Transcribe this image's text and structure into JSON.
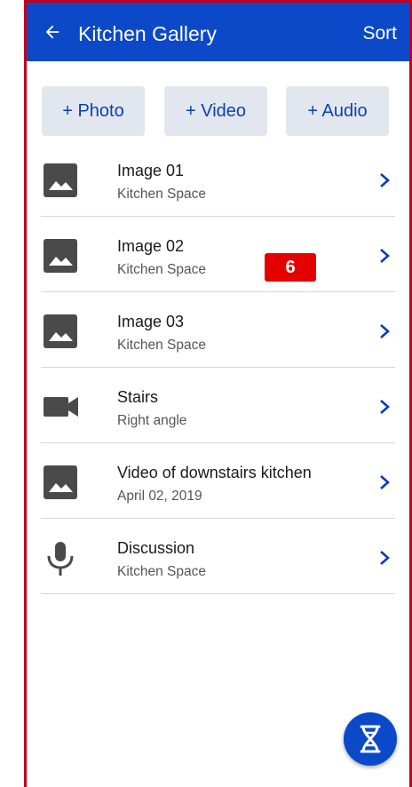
{
  "header": {
    "title": "Kitchen Gallery",
    "sort_label": "Sort"
  },
  "add_buttons": {
    "photo": "+ Photo",
    "video": "+ Video",
    "audio": "+ Audio"
  },
  "items": [
    {
      "title": "Image 01",
      "subtitle": "Kitchen Space",
      "icon": "image-icon"
    },
    {
      "title": "Image 02",
      "subtitle": "Kitchen Space",
      "icon": "image-icon"
    },
    {
      "title": "Image 03",
      "subtitle": "Kitchen Space",
      "icon": "image-icon"
    },
    {
      "title": "Stairs",
      "subtitle": "Right angle",
      "icon": "videocam-icon"
    },
    {
      "title": "Video of downstairs kitchen",
      "subtitle": "April 02, 2019",
      "icon": "image-icon"
    },
    {
      "title": "Discussion",
      "subtitle": "Kitchen Space",
      "icon": "microphone-icon"
    }
  ],
  "badge": "6",
  "fab_icon": "dna-icon",
  "colors": {
    "primary": "#0b49c9",
    "button_bg": "#e2e7ef",
    "badge": "#e40000",
    "frame_border": "#c0001d"
  }
}
